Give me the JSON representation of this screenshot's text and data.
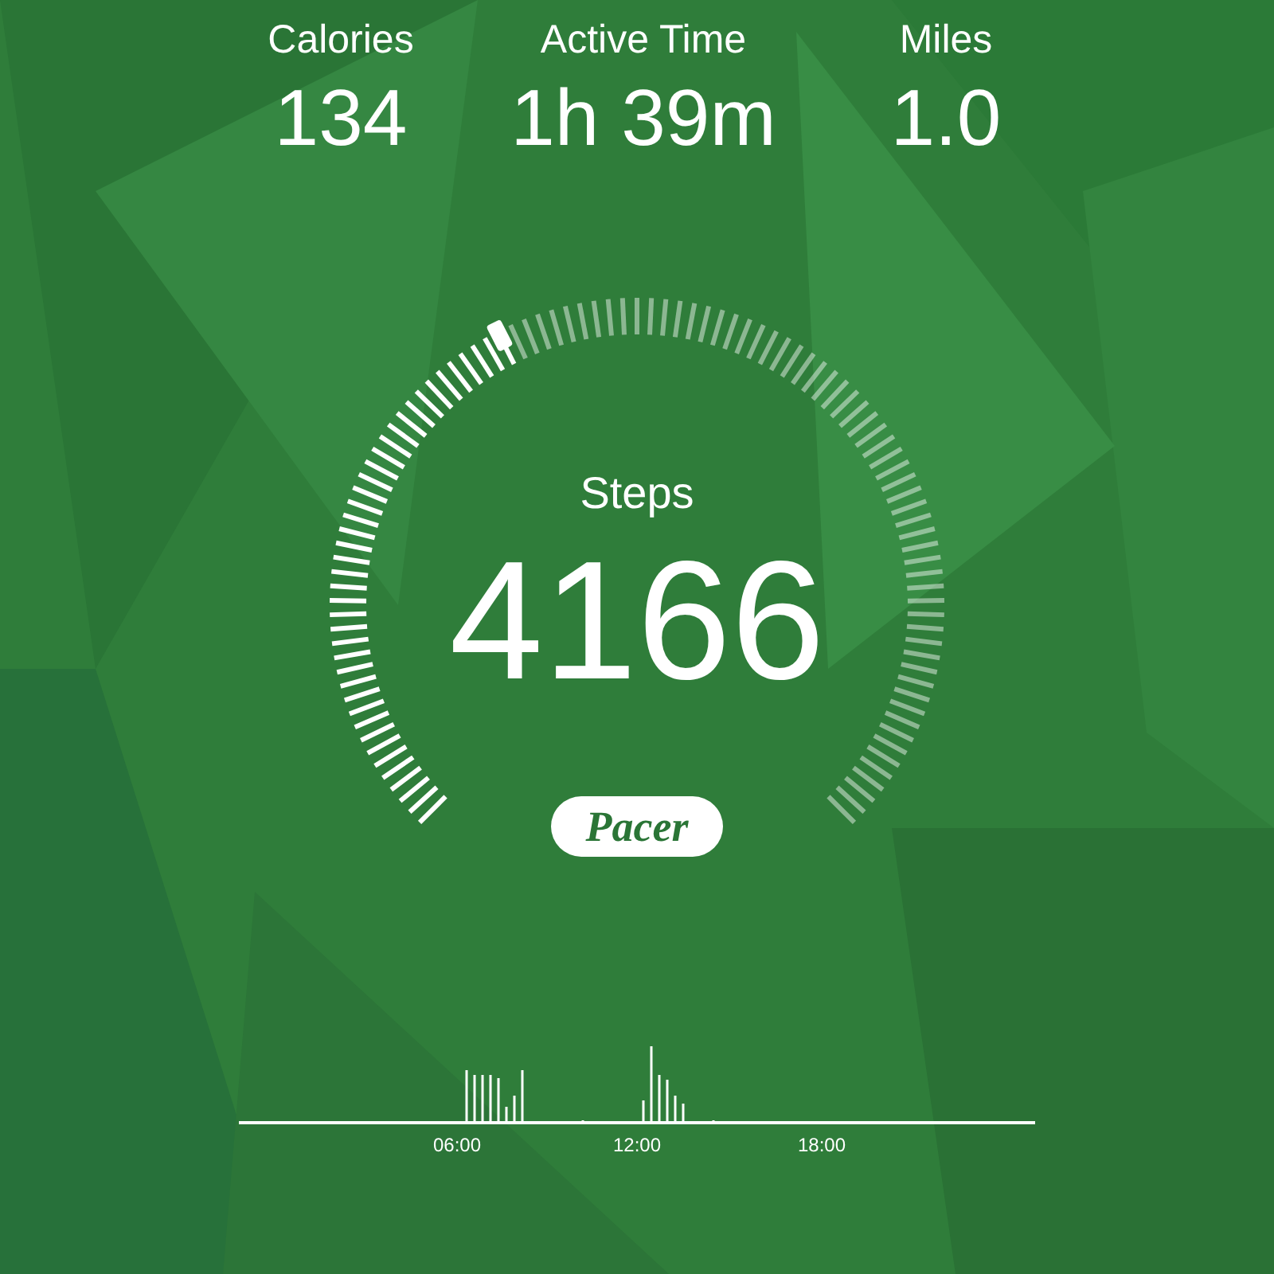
{
  "stats": [
    {
      "label": "Calories",
      "value": "134"
    },
    {
      "label": "Active Time",
      "value": "1h 39m"
    },
    {
      "label": "Miles",
      "value": "1.0"
    }
  ],
  "steps": {
    "label": "Steps",
    "value": "4166"
  },
  "logo": "Pacer",
  "activity_chart": {
    "tick_labels": [
      "06:00",
      "12:00",
      "18:00"
    ]
  }
}
